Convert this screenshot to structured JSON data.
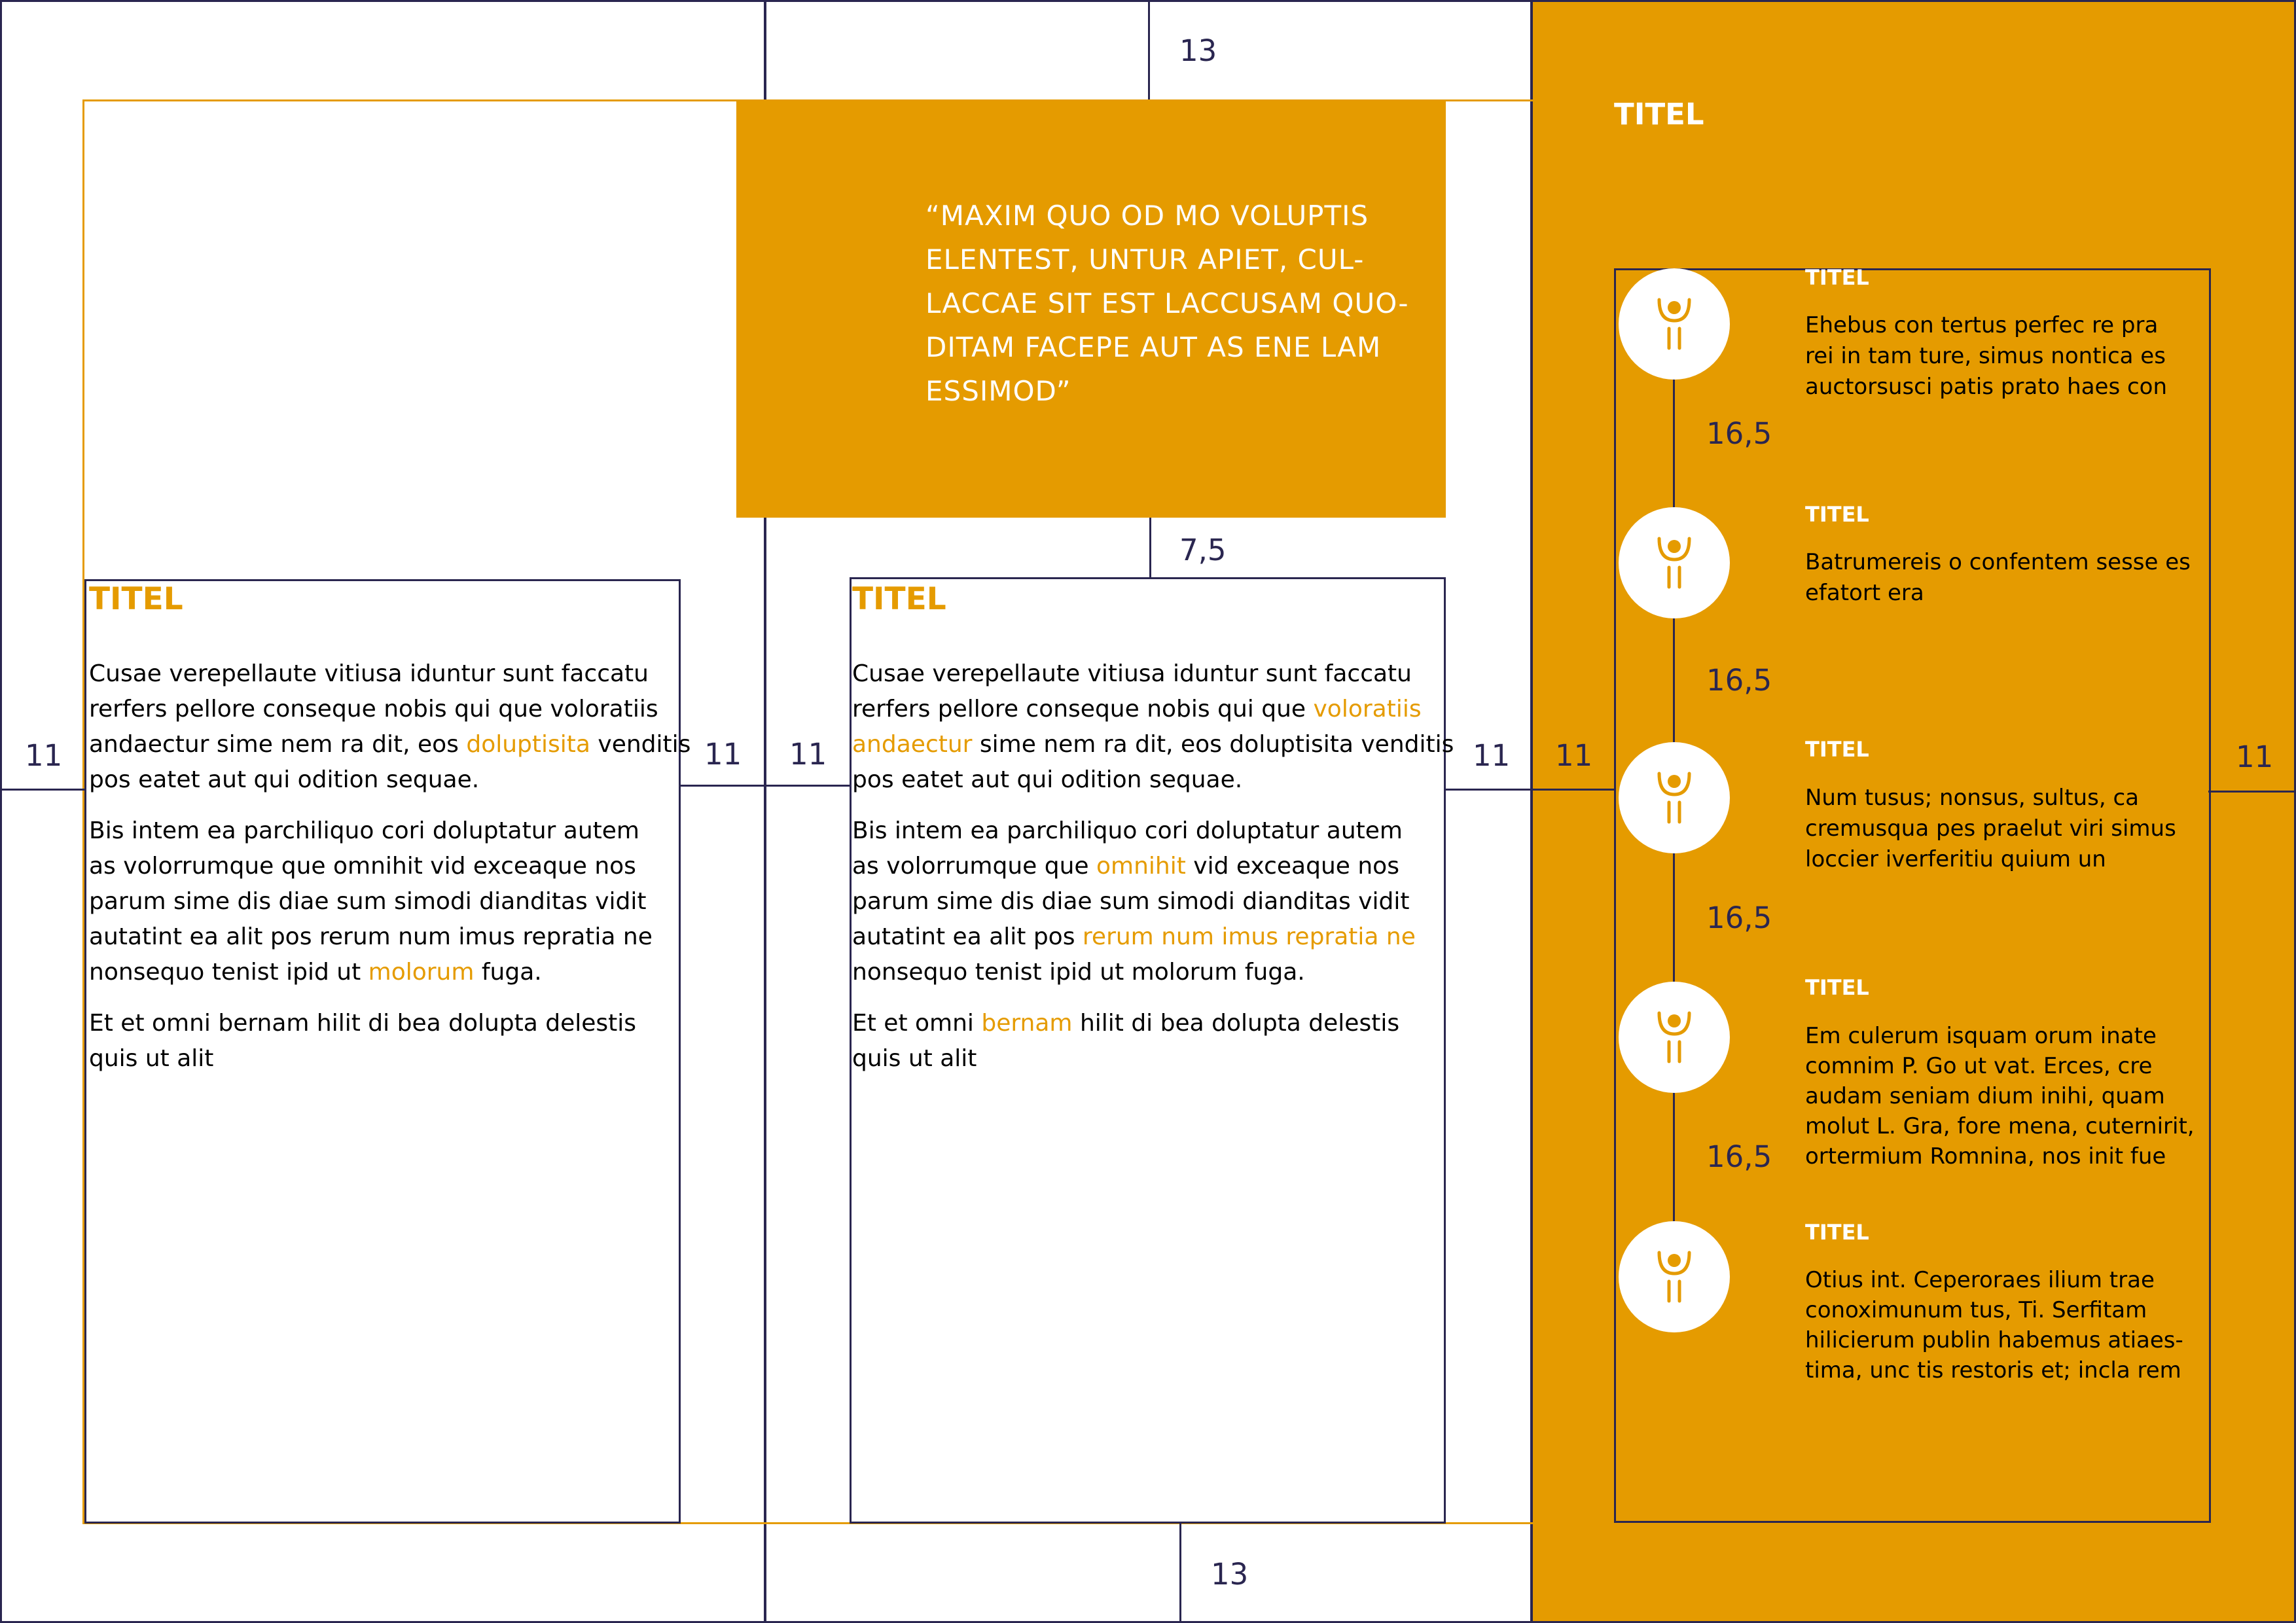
{
  "dimensions": {
    "top": "13",
    "quote_gap": "7,5",
    "bottom": "13",
    "left_margin": "11",
    "gutter_1a": "11",
    "gutter_1b": "11",
    "gutter_2": "11",
    "panel_left": "11",
    "panel_right": "11",
    "timeline_gaps": [
      "16,5",
      "16,5",
      "16,5",
      "16,5"
    ]
  },
  "quote": {
    "lines": "“MAXIM QUO OD MO VOLUPTIS\nELENTEST, UNTUR APIET, CUL-\nLACCAE SIT EST LACCUSAM QUO-\nDITAM FACEPE AUT AS ENE LAM\nESSIMOD”"
  },
  "column1": {
    "title": "TITEL",
    "p1": {
      "a": "Cusae verepellaute vitiusa iduntur sunt faccatu",
      "b": "rerfers pellore conseque nobis qui que voloratiis",
      "c": "andaectur sime nem ra dit, eos ",
      "d": "doluptisita",
      "e": " venditis",
      "f": "pos eatet aut qui odition sequae."
    },
    "p2": {
      "a": "Bis intem ea parchiliquo cori doluptatur autem",
      "b": "as volorrumque que omnihit vid exceaque nos",
      "c": "parum sime dis diae sum simodi dianditas vidit",
      "d": "autatint ea alit pos rerum num imus repratia ne",
      "e": "nonsequo tenist ipid ut ",
      "f": "molorum",
      "g": " fuga."
    },
    "p3": {
      "a": "Et et omni bernam hilit di bea dolupta delestis",
      "b": "quis ut alit"
    }
  },
  "column2": {
    "title": "TITEL",
    "p1": {
      "a": "Cusae verepellaute vitiusa iduntur sunt faccatu",
      "b": "rerfers pellore conseque nobis qui que ",
      "c": "voloratiis",
      "d": "andaectur",
      "e": " sime nem ra dit, eos doluptisita venditis",
      "f": "pos eatet aut qui odition sequae."
    },
    "p2": {
      "a": "Bis intem ea parchiliquo cori doluptatur autem",
      "b": "as volorrumque que ",
      "c": "omnihit",
      "d": " vid exceaque nos",
      "e": "parum sime dis diae sum simodi dianditas vidit",
      "f": "autatint ea alit pos ",
      "g": "rerum num imus repratia ne",
      "h": "nonsequo tenist ipid ut molorum fuga."
    },
    "p3": {
      "a": "Et et omni ",
      "b": "bernam",
      "c": " hilit di bea dolupta delestis",
      "d": "quis ut alit"
    }
  },
  "panel": {
    "title": "TITEL",
    "items": [
      {
        "title": "TITEL",
        "text": "Ehebus con tertus perfec re pra\nrei in tam ture, simus nontica es\nauctorsusci patis prato haes con"
      },
      {
        "title": "TITEL",
        "text": "Batrumereis o confentem sesse es\nefatort era"
      },
      {
        "title": "TITEL",
        "text": "Num tusus; nonsus, sultus, ca\ncremusqua pes praelut viri simus\nloccier iverferitiu quium un"
      },
      {
        "title": "TITEL",
        "text": "Em culerum isquam orum inate\ncomnim P. Go ut vat. Erces, cre\naudam seniam dium inihi, quam\nmolut L. Gra, fore mena, cuternirit,\nortermium Romnina, nos init fue"
      },
      {
        "title": "TITEL",
        "text": "Otius int. Ceperoraes ilium trae\nconoximunum tus, Ti. Serfitam\nhilicierum publin habemus atiaes-\ntima, unc tis restoris et; incla rem"
      }
    ]
  },
  "colors": {
    "accent": "#e59b00",
    "lines": "#2a2650",
    "background": "#ffffff"
  },
  "icons": [
    "person-icon",
    "person-icon",
    "person-icon",
    "person-icon",
    "person-icon"
  ]
}
